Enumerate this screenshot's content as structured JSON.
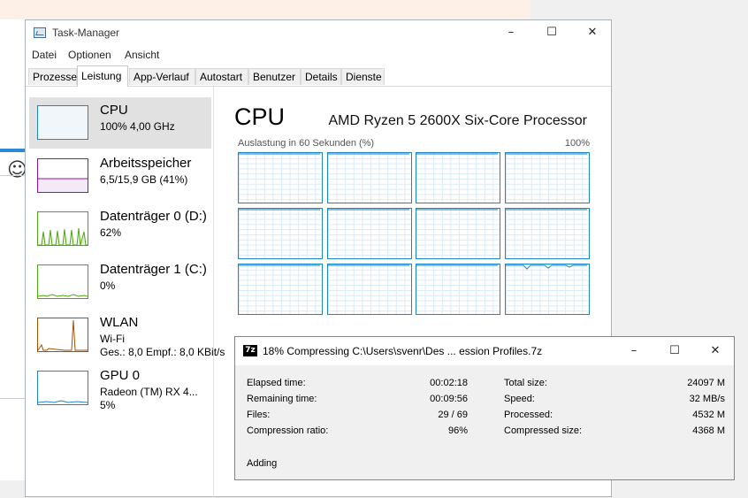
{
  "task_manager": {
    "title": "Task-Manager",
    "menu": [
      "Datei",
      "Optionen",
      "Ansicht"
    ],
    "tabs": [
      "Prozesse",
      "Leistung",
      "App-Verlauf",
      "Autostart",
      "Benutzer",
      "Details",
      "Dienste"
    ],
    "active_tab": "Leistung",
    "sidebar": [
      {
        "name": "CPU",
        "sub": "100% 4,00 GHz",
        "selected": true
      },
      {
        "name": "Arbeitsspeicher",
        "sub": "6,5/15,9 GB (41%)"
      },
      {
        "name": "Datenträger 0 (D:)",
        "sub": "62%"
      },
      {
        "name": "Datenträger 1 (C:)",
        "sub": "0%"
      },
      {
        "name": "WLAN",
        "sub": "Wi-Fi",
        "sub2": "Ges.: 8,0  Empf.: 8,0 KBit/s"
      },
      {
        "name": "GPU 0",
        "sub": "Radeon (TM) RX 4...",
        "sub2": "5%"
      }
    ],
    "main": {
      "heading": "CPU",
      "processor": "AMD Ryzen 5 2600X Six-Core Processor",
      "graph_caption": "Auslastung in 60 Sekunden (%)",
      "graph_max": "100%",
      "cores": 12
    }
  },
  "sevenzip": {
    "logo": "7z",
    "title": "18% Compressing C:\\Users\\svenr\\Des ... ession Profiles.7z",
    "left": [
      {
        "label": "Elapsed time:",
        "value": "00:02:18"
      },
      {
        "label": "Remaining time:",
        "value": "00:09:56"
      },
      {
        "label": "Files:",
        "value": "29 / 69"
      },
      {
        "label": "Compression ratio:",
        "value": "96%"
      }
    ],
    "right": [
      {
        "label": "Total size:",
        "value": "24097 M"
      },
      {
        "label": "Speed:",
        "value": "32 MB/s"
      },
      {
        "label": "Processed:",
        "value": "4532 M"
      },
      {
        "label": "Compressed size:",
        "value": "4368 M"
      }
    ],
    "status": "Adding"
  },
  "icons": {
    "minimize": "minimize-icon",
    "maximize": "maximize-icon",
    "close": "close-icon"
  },
  "colors": {
    "cpu": "#1e86c0",
    "memory": "#8b12ae",
    "disk": "#4da60c",
    "network": "#a74f01",
    "gpu": "#1e86c0"
  }
}
